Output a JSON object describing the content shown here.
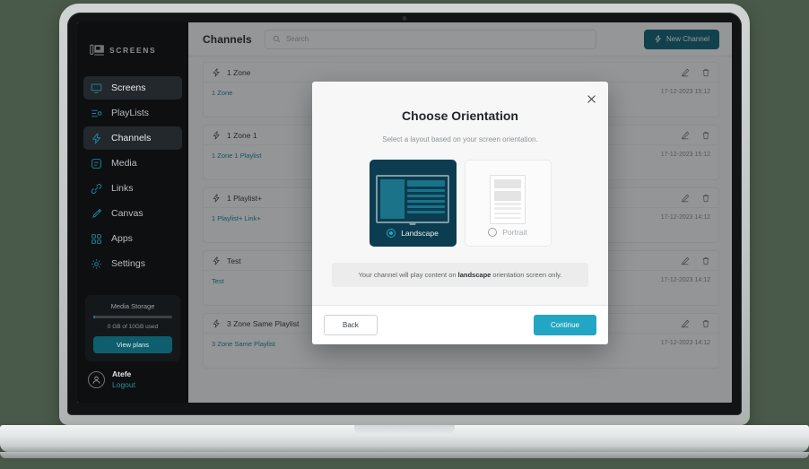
{
  "sidebar": {
    "logo_text": "SCREENS",
    "items": [
      {
        "label": "Screens",
        "icon": "monitor-icon",
        "active": false
      },
      {
        "label": "PlayLists",
        "icon": "playlist-icon",
        "active": false
      },
      {
        "label": "Channels",
        "icon": "bolt-icon",
        "active": true
      },
      {
        "label": "Media",
        "icon": "media-icon",
        "active": false
      },
      {
        "label": "Links",
        "icon": "link-icon",
        "active": false
      },
      {
        "label": "Canvas",
        "icon": "brush-icon",
        "active": false
      },
      {
        "label": "Apps",
        "icon": "grid-icon",
        "active": false
      },
      {
        "label": "Settings",
        "icon": "gear-icon",
        "active": false
      }
    ],
    "storage": {
      "title": "Media Storage",
      "used_text": "0 GB of 10GB used",
      "percent": 2,
      "button_label": "View plans"
    },
    "user": {
      "name": "Atefe",
      "logout_label": "Logout"
    }
  },
  "header": {
    "title": "Channels",
    "search_placeholder": "Search",
    "search_value": "",
    "new_channel_label": "New Channel"
  },
  "channels": [
    {
      "name": "1 Zone",
      "link": "1 Zone",
      "date": "17-12-2023 15:12"
    },
    {
      "name": "1 Zone 1",
      "link": "1 Zone 1 Playlist",
      "date": "17-12-2023 15:12"
    },
    {
      "name": "1 Playlist+",
      "link": "1 Playlist+ Link+",
      "date": "17-12-2023 14:12"
    },
    {
      "name": "Test",
      "link": "Test",
      "date": "17-12-2023 14:12"
    },
    {
      "name": "3 Zone Same Playlist",
      "link": "3 Zone Same Playlist",
      "date": "17-12-2023 14:12"
    }
  ],
  "modal": {
    "title": "Choose Orientation",
    "subtitle": "Select a layout based on your screen orientation.",
    "close_label": "×",
    "options": [
      {
        "label": "Landscape",
        "selected": true
      },
      {
        "label": "Portrait",
        "selected": false
      }
    ],
    "note_prefix": "Your channel will play content on ",
    "note_bold": "landscape",
    "note_suffix": " orientation screen only.",
    "back_label": "Back",
    "continue_label": "Continue"
  },
  "colors": {
    "sidebar_bg": "#0d0f11",
    "accent_teal": "#1d7f91",
    "primary_button": "#0d6276",
    "continue_button": "#23a6c4",
    "selected_card": "#0c3c4f",
    "link": "#1d8499"
  }
}
